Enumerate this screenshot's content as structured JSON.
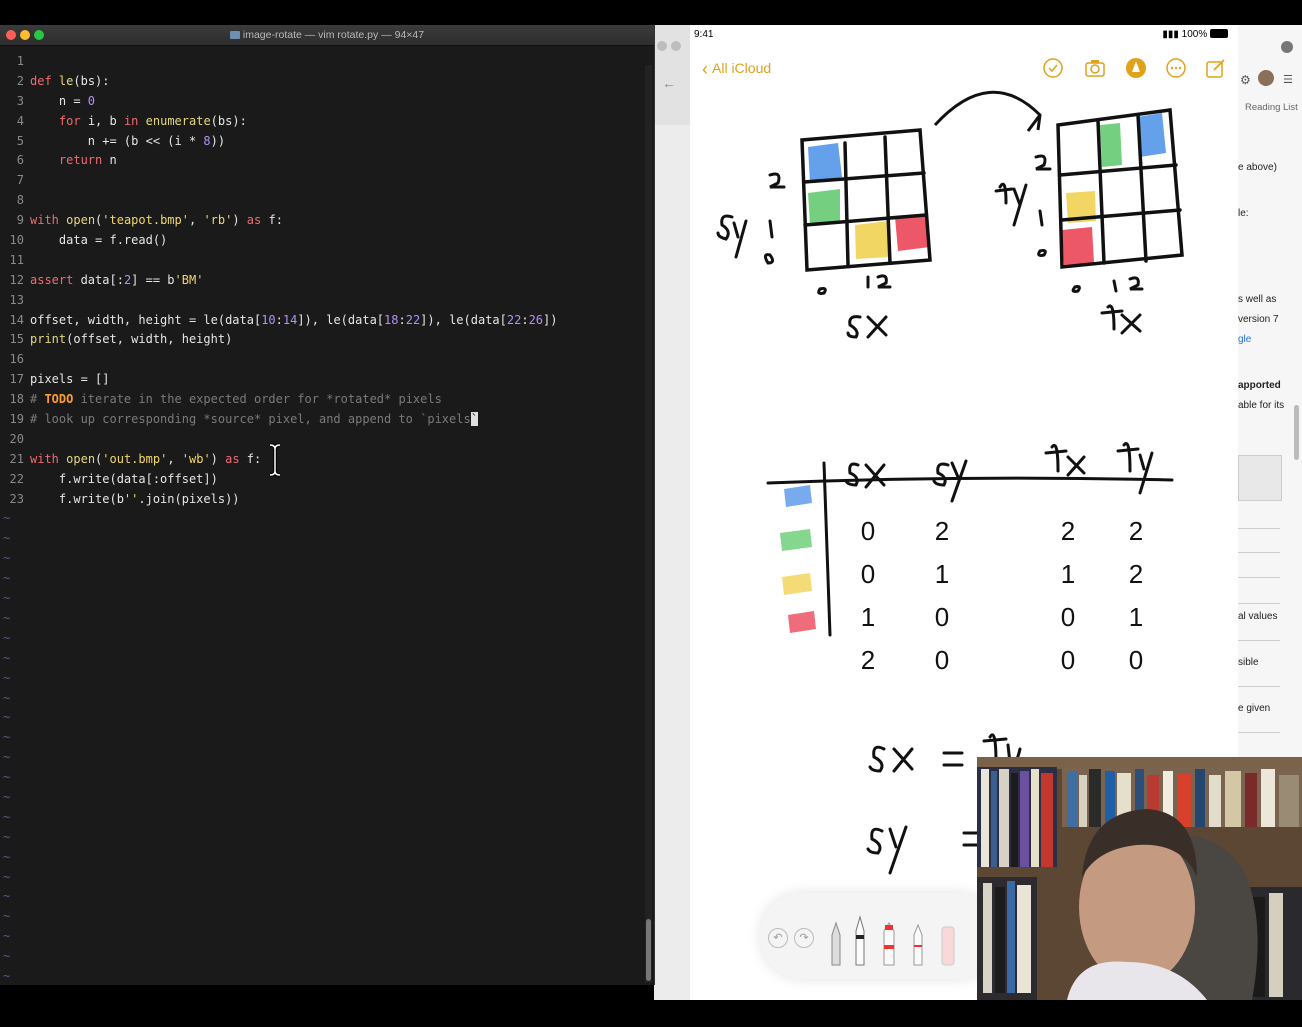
{
  "terminal": {
    "title": "image-rotate — vim rotate.py — 94×47",
    "lines": [
      {
        "n": "1",
        "html": ""
      },
      {
        "n": "2",
        "html": "<span class='kw'>def</span> <span class='fn'>le</span>(bs):"
      },
      {
        "n": "3",
        "html": "    n = <span class='num'>0</span>"
      },
      {
        "n": "4",
        "html": "    <span class='kw'>for</span> i, b <span class='kw'>in</span> <span class='fn'>enumerate</span>(bs):"
      },
      {
        "n": "5",
        "html": "        n += (b &lt;&lt; (i * <span class='num'>8</span>))"
      },
      {
        "n": "6",
        "html": "    <span class='kw'>return</span> n"
      },
      {
        "n": "7",
        "html": ""
      },
      {
        "n": "8",
        "html": ""
      },
      {
        "n": "9",
        "html": "<span class='kw'>with</span> <span class='fn'>open</span>(<span class='str'>'teapot.bmp'</span>, <span class='str'>'rb'</span>) <span class='kw'>as</span> f:"
      },
      {
        "n": "10",
        "html": "    data = f.read()"
      },
      {
        "n": "11",
        "html": ""
      },
      {
        "n": "12",
        "html": "<span class='kw'>assert</span> data[:<span class='num'>2</span>] == b<span class='str'>'BM'</span>"
      },
      {
        "n": "13",
        "html": ""
      },
      {
        "n": "14",
        "html": "offset, width, height = le(data[<span class='num'>10</span>:<span class='num'>14</span>]), le(data[<span class='num'>18</span>:<span class='num'>22</span>]), le(data[<span class='num'>22</span>:<span class='num'>26</span>])"
      },
      {
        "n": "15",
        "html": "<span class='fn'>print</span>(offset, width, height)"
      },
      {
        "n": "16",
        "html": ""
      },
      {
        "n": "17",
        "html": "pixels = []"
      },
      {
        "n": "18",
        "html": "<span class='cm'># </span><span class='todo'>TODO</span><span class='cm'> iterate in the expected order for *rotated* pixels</span>"
      },
      {
        "n": "19",
        "html": "<span class='cm'># look up corresponding *source* pixel, and append to `pixels</span><span class='cur'>`</span>"
      },
      {
        "n": "20",
        "html": ""
      },
      {
        "n": "21",
        "html": "<span class='kw'>with</span> <span class='fn'>open</span>(<span class='str'>'out.bmp'</span>, <span class='str'>'wb'</span>) <span class='kw'>as</span> f:"
      },
      {
        "n": "22",
        "html": "    f.write(data[:offset])"
      },
      {
        "n": "23",
        "html": "    f.write(b<span class='str'>''</span>.join(pixels))"
      }
    ],
    "tilde_count": 24
  },
  "ipad": {
    "time": "9:41",
    "battery": "100%",
    "back_label": "All iCloud"
  },
  "browser": {
    "reading_list": "Reading List",
    "snippets": [
      {
        "text": "e above)",
        "cls": ""
      },
      {
        "text": "le:",
        "cls": ""
      },
      {
        "text": "s well as",
        "cls": ""
      },
      {
        "text": "version 7",
        "cls": ""
      },
      {
        "text": "gle",
        "cls": "link"
      },
      {
        "text": "apported",
        "cls": "bold"
      },
      {
        "text": "able for its",
        "cls": ""
      },
      {
        "text": "al values",
        "cls": ""
      },
      {
        "text": "sible",
        "cls": ""
      },
      {
        "text": "e given",
        "cls": ""
      }
    ]
  },
  "notes_drawing": {
    "grid_axis_labels": [
      "sy",
      "sx",
      "ty",
      "tx"
    ],
    "table_headers": [
      "sx",
      "sy",
      "tx",
      "ty"
    ],
    "table_rows": [
      {
        "color": "#4a8fe8",
        "sx": "0",
        "sy": "2",
        "tx": "2",
        "ty": "2"
      },
      {
        "color": "#5cc86a",
        "sx": "0",
        "sy": "1",
        "tx": "1",
        "ty": "2"
      },
      {
        "color": "#f0cf48",
        "sx": "1",
        "sy": "0",
        "tx": "0",
        "ty": "1"
      },
      {
        "color": "#ea3b4e",
        "sx": "2",
        "sy": "0",
        "tx": "0",
        "ty": "0"
      }
    ],
    "equations": [
      "sx = tu",
      "sy ="
    ]
  }
}
